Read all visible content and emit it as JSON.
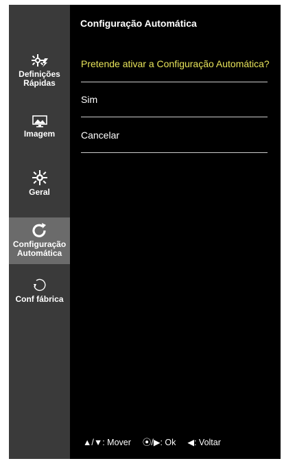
{
  "sidebar": {
    "items": [
      {
        "line1": "Definições",
        "line2": "Rápidas",
        "icon": "quick-settings-icon"
      },
      {
        "line1": "Imagem",
        "icon": "picture-icon"
      },
      {
        "line1": "Geral",
        "icon": "gear-icon"
      },
      {
        "line1": "Configuração",
        "line2": "Automática",
        "icon": "auto-config-icon",
        "selected": true
      },
      {
        "line1": "Conf fábrica",
        "icon": "reset-icon"
      }
    ]
  },
  "main": {
    "title": "Configuração Automática",
    "question": "Pretende ativar a Configuração Automática?",
    "options": [
      "Sim",
      "Cancelar"
    ]
  },
  "footer": {
    "move_symbol": "▲/▼",
    "move_label": ": Mover",
    "ok_symbol": "⦿/▶",
    "ok_label": ": Ok",
    "back_symbol": "◀",
    "back_label": ": Voltar"
  },
  "colors": {
    "question": "#e8e45a",
    "sidebar_bg": "#3a3a3a",
    "sidebar_selected": "#6b6b6b"
  }
}
